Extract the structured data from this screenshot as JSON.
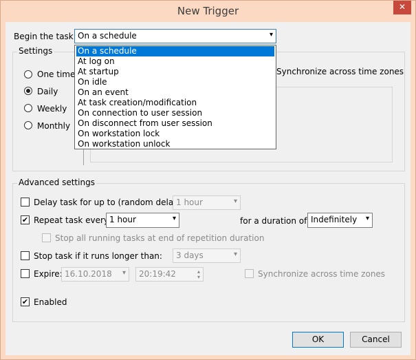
{
  "window": {
    "title": "New Trigger",
    "close_glyph": "✕"
  },
  "begin": {
    "label": "Begin the task:",
    "selected": "On a schedule"
  },
  "dropdown_options": [
    "On a schedule",
    "At log on",
    "At startup",
    "On idle",
    "On an event",
    "At task creation/modification",
    "On connection to user session",
    "On disconnect from user session",
    "On workstation lock",
    "On workstation unlock"
  ],
  "settings": {
    "label": "Settings",
    "radios": [
      {
        "label": "One time",
        "checked": false
      },
      {
        "label": "Daily",
        "checked": true
      },
      {
        "label": "Weekly",
        "checked": false
      },
      {
        "label": "Monthly",
        "checked": false
      }
    ],
    "sync_label": "Synchronize across time zones"
  },
  "advanced": {
    "label": "Advanced settings",
    "delay_label": "Delay task for up to (random delay):",
    "delay_value": "1 hour",
    "repeat_label": "Repeat task every:",
    "repeat_value": "1 hour",
    "duration_label": "for a duration of:",
    "duration_value": "Indefinitely",
    "stop_all_label": "Stop all running tasks at end of repetition duration",
    "stop_longer_label": "Stop task if it runs longer than:",
    "stop_longer_value": "3 days",
    "expire_label": "Expire:",
    "expire_date": "16.10.2018",
    "expire_time": "20:19:42",
    "expire_sync_label": "Synchronize across time zones",
    "enabled_label": "Enabled",
    "check_glyph": "✔"
  },
  "buttons": {
    "ok": "OK",
    "cancel": "Cancel"
  },
  "colors": {
    "titlebar": "#fbd9c2",
    "close": "#c7493b",
    "selection": "#0078d7"
  }
}
